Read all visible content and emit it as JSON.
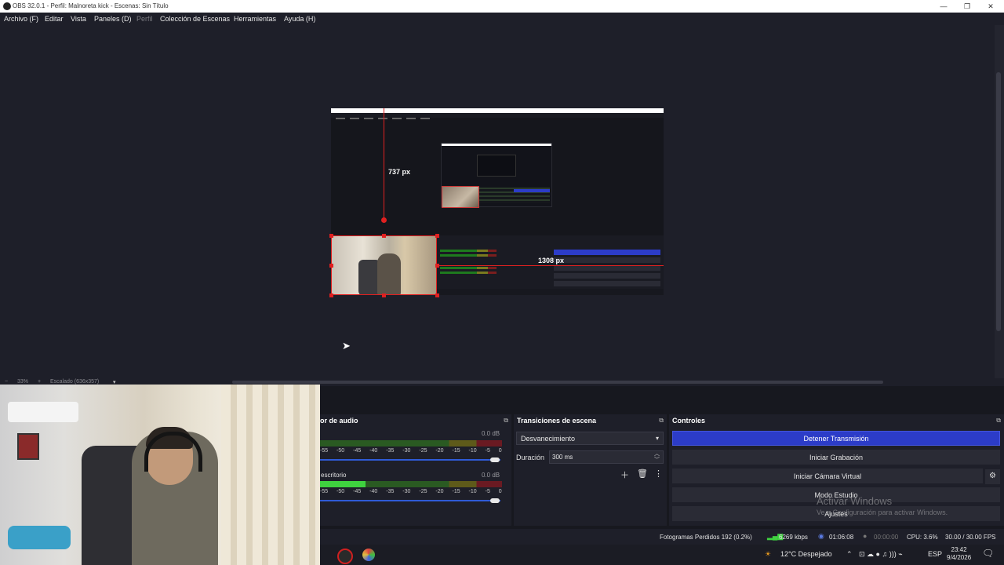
{
  "window": {
    "title": "OBS 32.0.1 - Perfil: Malnoreta kick - Escenas: Sin Título",
    "controls": [
      "—",
      "❐",
      "✕"
    ]
  },
  "menu": [
    "Archivo (F)",
    "Editar",
    "Vista",
    "Paneles (D)",
    "Perfil",
    "Colección de Escenas",
    "Herramientas",
    "Ayuda (H)"
  ],
  "preview": {
    "measure_vertical": "737 px",
    "measure_horizontal": "1308 px",
    "zoom_percent": "33%",
    "zoom_minus": "−",
    "zoom_plus": "+",
    "scaling": "Escalado (636x357)",
    "scaling_arrow": "▾"
  },
  "audio_mixer": {
    "title": "or de audio",
    "tracks": [
      {
        "name": "",
        "db": "0.0 dB",
        "level": 0.0,
        "volume": 0.98
      },
      {
        "name": "escritorio",
        "db": "0.0 dB",
        "level": 0.25,
        "volume": 0.98
      }
    ],
    "scale": "-55 -50 -45 -40 -35 -30 -25 -20 -15 -10 -5 0"
  },
  "transitions": {
    "title": "Transiciones de escena",
    "selected": "Desvanecimiento",
    "duration_label": "Duración",
    "duration_value": "300 ms"
  },
  "controls": {
    "title": "Controles",
    "stop_stream": "Detener Transmisión",
    "start_recording": "Iniciar Grabación",
    "virtual_camera": "Iniciar Cámara Virtual",
    "studio_mode": "Modo Estudio",
    "settings": "Ajustes"
  },
  "watermark": {
    "line1": "Activar Windows",
    "line2": "Ve a Configuración para activar Windows."
  },
  "status": {
    "dropped_frames": "Fotogramas Perdidos 192 (0.2%)",
    "bitrate": "6269 kbps",
    "stream_time": "01:06:08",
    "record_time": "00:00:00",
    "cpu": "CPU: 3.6%",
    "fps": "30.00 / 30.00 FPS"
  },
  "taskbar": {
    "weather": "12°C Despejado",
    "language": "ESP",
    "time": "23:42",
    "date": "9/4/2026"
  },
  "colors": {
    "accent_blue": "#2c3cc8",
    "selection_red": "#e02020",
    "background": "#1e1f29"
  }
}
